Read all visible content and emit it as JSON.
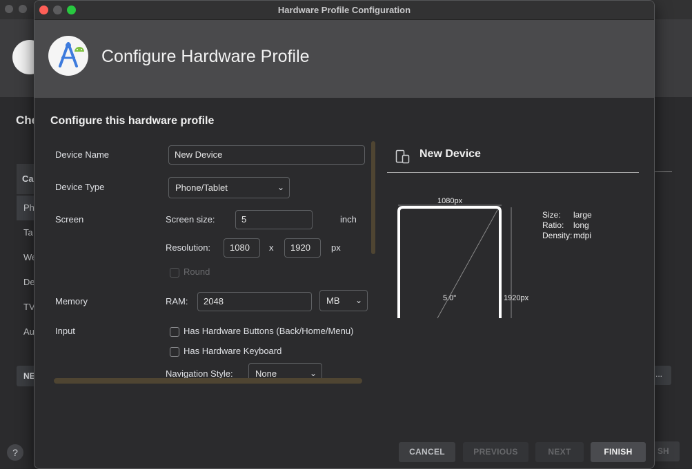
{
  "window_title": "Hardware Profile Configuration",
  "header_title": "Configure Hardware Profile",
  "section_title": "Configure this hardware profile",
  "background": {
    "heading": "Che",
    "category_label": "Ca",
    "list_items": [
      "Ph",
      "Ta",
      "We",
      "De",
      "TV",
      "Au"
    ],
    "new_button": "NE",
    "clone_button": "...",
    "finish_button": "SH",
    "help": "?"
  },
  "form": {
    "device_name_label": "Device Name",
    "device_name_value": "New Device",
    "device_type_label": "Device Type",
    "device_type_value": "Phone/Tablet",
    "screen_label": "Screen",
    "screen_size_label": "Screen size:",
    "screen_size_value": "5",
    "screen_size_unit": "inch",
    "resolution_label": "Resolution:",
    "resolution_width": "1080",
    "resolution_x": "x",
    "resolution_height": "1920",
    "resolution_unit": "px",
    "round_label": "Round",
    "memory_label": "Memory",
    "ram_label": "RAM:",
    "ram_value": "2048",
    "ram_unit": "MB",
    "input_label": "Input",
    "hw_buttons_label": "Has Hardware Buttons (Back/Home/Menu)",
    "hw_keyboard_label": "Has Hardware Keyboard",
    "nav_style_label": "Navigation Style:",
    "nav_style_value": "None"
  },
  "preview": {
    "device_name": "New Device",
    "width_label": "1080px",
    "height_label": "1920px",
    "diagonal_label": "5.0\"",
    "specs": [
      {
        "key": "Size:",
        "value": "large"
      },
      {
        "key": "Ratio:",
        "value": "long"
      },
      {
        "key": "Density:",
        "value": "mdpi"
      }
    ]
  },
  "buttons": {
    "cancel": "CANCEL",
    "previous": "PREVIOUS",
    "next": "NEXT",
    "finish": "FINISH"
  },
  "icons": {
    "logo": "android-studio-logo-icon",
    "device": "phone-tablet-icon"
  }
}
